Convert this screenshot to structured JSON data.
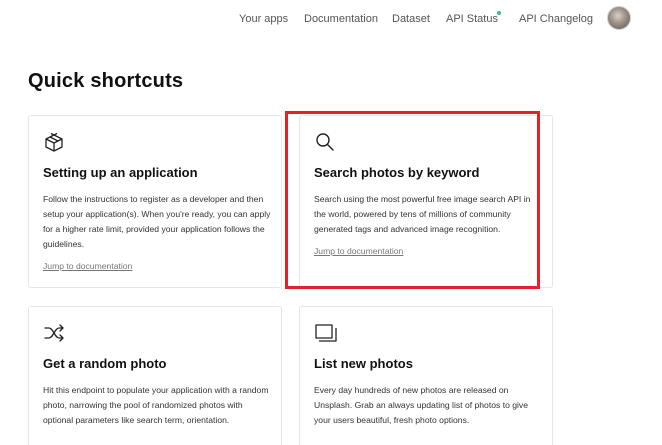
{
  "nav": {
    "links": [
      "Your apps",
      "Documentation",
      "Dataset",
      "API Status",
      "API Changelog"
    ]
  },
  "page": {
    "title": "Quick shortcuts"
  },
  "cards": [
    {
      "icon": "package-icon",
      "title": "Setting up an application",
      "description": "Follow the instructions to register as a developer and then setup your application(s). When you're ready, you can apply for a higher rate limit, provided your application follows the guidelines.",
      "link": "Jump to documentation"
    },
    {
      "icon": "search-icon",
      "title": "Search photos by keyword",
      "description": "Search using the most powerful free image search API in the world, powered by tens of millions of community generated tags and advanced image recognition.",
      "link": "Jump to documentation"
    },
    {
      "icon": "shuffle-icon",
      "title": "Get a random photo",
      "description": "Hit this endpoint to populate your application with a random photo, narrowing the pool of randomized photos with optional parameters like search term, orientation.",
      "link": ""
    },
    {
      "icon": "photos-stack-icon",
      "title": "List new photos",
      "description": "Every day hundreds of new photos are released on Unsplash. Grab an always updating list of photos to give your users beautiful, fresh photo options.",
      "link": ""
    }
  ],
  "colors": {
    "highlight": "#e2222b",
    "status_dot": "#3cbc8d",
    "card_border": "#e6e6e6"
  }
}
